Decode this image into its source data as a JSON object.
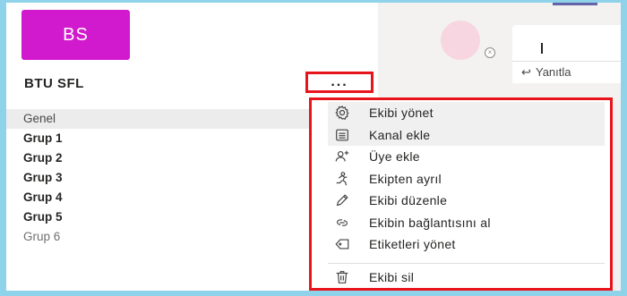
{
  "team": {
    "avatar_initials": "BS",
    "avatar_color": "#d11ace",
    "name": "BTU SFL",
    "more_label": "..."
  },
  "channels": [
    {
      "label": "Genel",
      "selected": true,
      "bold": false
    },
    {
      "label": "Grup 1",
      "selected": false,
      "bold": true
    },
    {
      "label": "Grup 2",
      "selected": false,
      "bold": true
    },
    {
      "label": "Grup 3",
      "selected": false,
      "bold": true
    },
    {
      "label": "Grup 4",
      "selected": false,
      "bold": true
    },
    {
      "label": "Grup 5",
      "selected": false,
      "bold": true
    },
    {
      "label": "Grup 6",
      "selected": false,
      "bold": false
    }
  ],
  "chat": {
    "reply_label": "Yanıtla"
  },
  "menu": {
    "items": [
      {
        "label": "Ekibi yönet",
        "icon": "gear-icon"
      },
      {
        "label": "Kanal ekle",
        "icon": "channel-list-icon"
      },
      {
        "label": "Üye ekle",
        "icon": "add-member-icon"
      },
      {
        "label": "Ekipten ayrıl",
        "icon": "leave-icon"
      },
      {
        "label": "Ekibi düzenle",
        "icon": "pencil-icon"
      },
      {
        "label": "Ekibin bağlantısını al",
        "icon": "link-icon"
      },
      {
        "label": "Etiketleri yönet",
        "icon": "tag-icon"
      }
    ],
    "delete_item": {
      "label": "Ekibi sil",
      "icon": "trash-icon"
    }
  },
  "colors": {
    "highlight_border": "#e8141c",
    "accent": "#6264a7",
    "background": "#8fd3ea"
  }
}
